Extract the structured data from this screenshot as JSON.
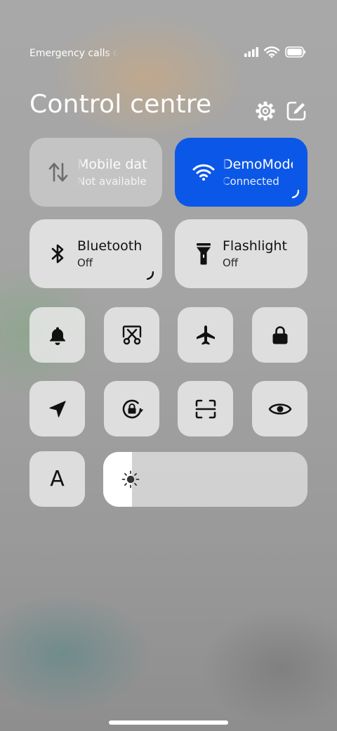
{
  "status_bar": {
    "carrier": "Emergency calls only",
    "icons": [
      "signal-icon",
      "wifi-icon",
      "battery-icon"
    ]
  },
  "header": {
    "title": "Control centre",
    "icons": [
      "gear-icon",
      "edit-icon"
    ]
  },
  "tiles": {
    "mobile_data": {
      "name": "Mobile data",
      "status": "Not available",
      "icon": "mobile-data-icon"
    },
    "wifi": {
      "name": "DemoMode",
      "status": "Connected",
      "icon": "wifi-icon",
      "accent": "#0b57e8"
    },
    "bluetooth": {
      "name": "Bluetooth",
      "status": "Off",
      "icon": "bluetooth-icon"
    },
    "flashlight": {
      "name": "Flashlight",
      "status": "Off",
      "icon": "flashlight-icon"
    }
  },
  "toggles_row1": [
    "bell-icon",
    "screenshot-icon",
    "airplane-icon",
    "lock-icon"
  ],
  "toggles_row2": [
    "location-icon",
    "rotation-lock-icon",
    "scanner-icon",
    "eye-icon"
  ],
  "font_size_tile": {
    "label": "A",
    "icon": "font-size-icon"
  },
  "brightness": {
    "level": 0.14,
    "icon": "brightness-icon"
  }
}
